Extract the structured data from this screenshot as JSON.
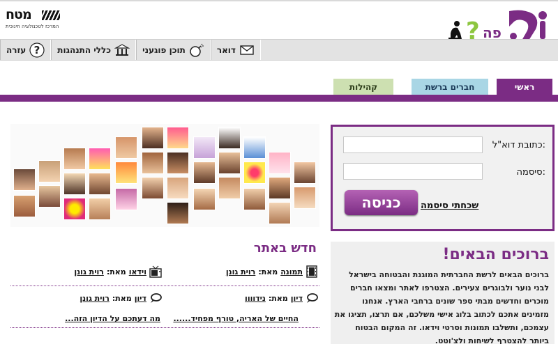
{
  "brand": {
    "name": "מטח",
    "tagline": "המרכז לטכנולוגיה חינוכית",
    "site_logo": "מיפה"
  },
  "toolbar": {
    "items": [
      {
        "label": "דואר",
        "icon": "envelope-icon"
      },
      {
        "label": "תוכן פוגעני",
        "icon": "bomb-icon"
      },
      {
        "label": "כללי התנהגות",
        "icon": "columns-building-icon"
      },
      {
        "label": "עזרה",
        "icon": "question-icon"
      }
    ]
  },
  "tabs": {
    "main": "ראשי",
    "friends": "חברים ברשת",
    "communities": "קהילות"
  },
  "login": {
    "email_label": "כתובת דוא\"ל:",
    "password_label": "סיסמה:",
    "login_button": "כניסה",
    "forgot_link": "שכחתי סיסמה"
  },
  "news": {
    "title": "חדש באתר",
    "items": [
      {
        "kind": "תמונה",
        "by": "מאת:",
        "name": "רוית גונן",
        "icon": "film-icon"
      },
      {
        "kind": "וידאו",
        "by": "מאת:",
        "name": "רוית גונן",
        "icon": "tv-icon"
      },
      {
        "kind": "דיון",
        "by": "מאת:",
        "name": "נידוווו",
        "icon": "speech-bubble-icon"
      },
      {
        "kind": "דיון",
        "by": "מאת:",
        "name": "רוית גונן",
        "icon": "speech-bubble-icon"
      }
    ],
    "links": [
      "החיים של האריה, טורף מפחיד......",
      "מה דעתכם על הדיון הזה..."
    ]
  },
  "welcome": {
    "title": "ברוכים הבאים!",
    "text": "ברוכים הבאים לרשת החברתית המוגנת והבטוחה בישראל לבני נוער ולבוגרים צעירים. הצטרפו לאתר ומצאו חברים מוכרים וחדשים מבתי ספר שונים ברחבי הארץ. אנחנו מזמינים אתכם לכתוב בלוג אישי משלכם, אם תרצו, תציגו את עצמכם, ותשלבו תמונות וסרטי וידאו. זה המקום הבטוח ביותר להצטרף לשיחות ולצ'וטט."
  },
  "colors": {
    "purple": "#7b2c84",
    "tab_blue": "#a9d6e5",
    "tab_green": "#cde0b1"
  }
}
